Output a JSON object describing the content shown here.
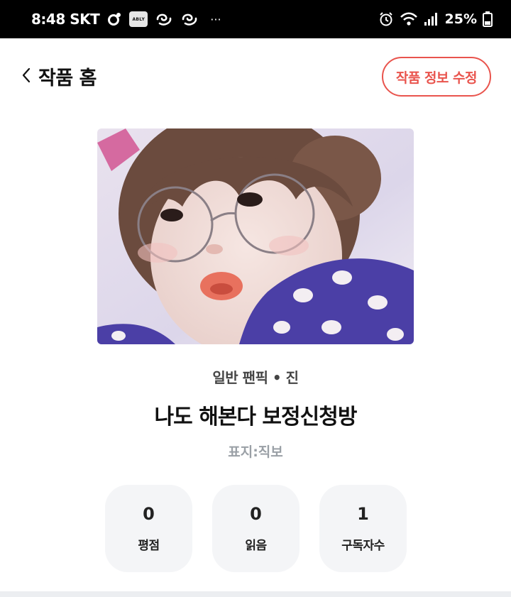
{
  "status_bar": {
    "time": "8:48 SKT",
    "app_badge": "ABLY",
    "more": "···",
    "battery": "25%"
  },
  "header": {
    "title": "작품 홈",
    "edit_button": "작품 정보 수정"
  },
  "work": {
    "genre": "일반 팬픽 • 진",
    "title": "나도 해본다 보정신청방",
    "subtitle": "표지:직보"
  },
  "stats": [
    {
      "value": "0",
      "label": "평점"
    },
    {
      "value": "0",
      "label": "읽음"
    },
    {
      "value": "1",
      "label": "구독자수"
    }
  ],
  "colors": {
    "accent": "#e9544d",
    "card_bg": "#f4f5f7",
    "muted_text": "#9aa0a6"
  }
}
